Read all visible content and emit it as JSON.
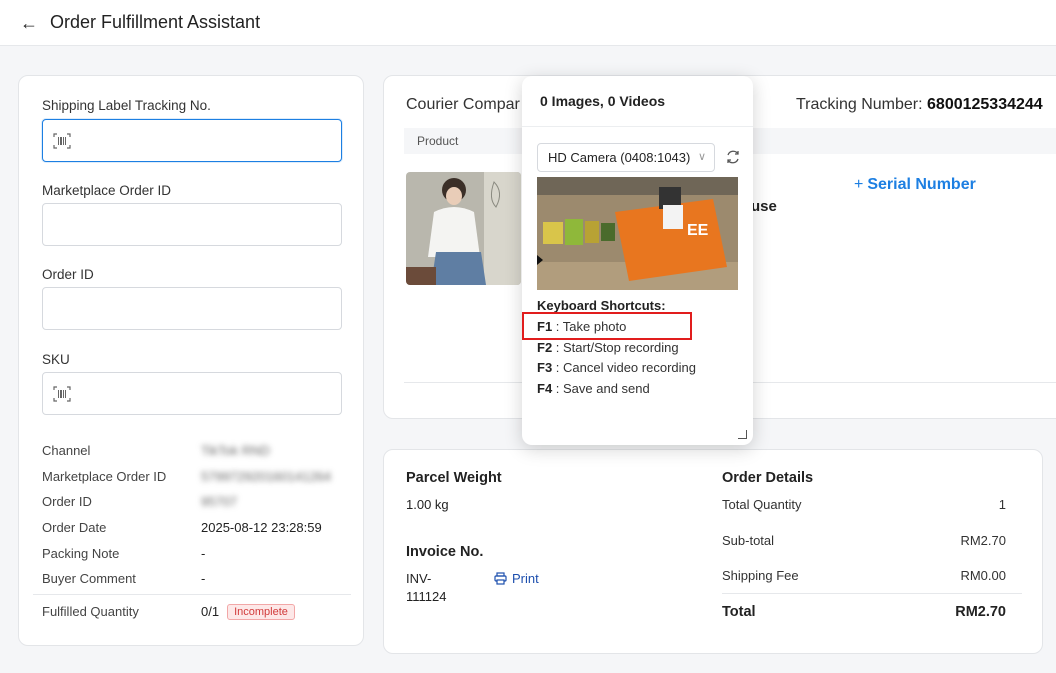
{
  "header": {
    "back_icon": "arrow-left-icon",
    "title": "Order Fulfillment Assistant"
  },
  "left_form": {
    "tracking_label": "Shipping Label Tracking No.",
    "tracking_value": "",
    "marketplace_order_label": "Marketplace Order ID",
    "marketplace_order_value": "",
    "order_id_label": "Order ID",
    "order_id_value": "",
    "sku_label": "SKU",
    "sku_value": ""
  },
  "order_info": [
    {
      "key": "Channel",
      "value": "TikTok RND",
      "blurred": true
    },
    {
      "key": "Marketplace Order ID",
      "value": "579972920160141264",
      "blurred": true
    },
    {
      "key": "Order ID",
      "value": "95707",
      "blurred": true
    },
    {
      "key": "Order Date",
      "value": "2025-08-12 23:28:59",
      "blurred": false
    },
    {
      "key": "Packing Note",
      "value": "-",
      "blurred": false
    },
    {
      "key": "Buyer Comment",
      "value": "-",
      "blurred": false
    }
  ],
  "fulfilled": {
    "label": "Fulfilled Quantity",
    "value": "0/1",
    "status": "Incomplete"
  },
  "shipment": {
    "courier_label": "Courier Compar",
    "tracking_label": "Tracking Number:",
    "tracking_number": "6800125334244",
    "product_header": "Product",
    "house_text": "use",
    "serial_plus": "+",
    "serial_label": "Serial Number"
  },
  "parcel": {
    "weight_title": "Parcel Weight",
    "weight_value": "1.00 kg",
    "invoice_title": "Invoice No.",
    "invoice_value_line1": "INV-",
    "invoice_value_line2": "111124",
    "print_label": "Print"
  },
  "order_details": {
    "title": "Order Details",
    "total_quantity_label": "Total Quantity",
    "total_quantity_value": "1",
    "subtotal_label": "Sub-total",
    "subtotal_value": "RM2.70",
    "shipping_label": "Shipping Fee",
    "shipping_value": "RM0.00",
    "total_label": "Total",
    "total_value": "RM2.70"
  },
  "camera_popup": {
    "header": "0 Images, 0 Videos",
    "camera_selected": "HD Camera (0408:1043)",
    "shortcuts_title": "Keyboard Shortcuts:",
    "shortcuts": [
      {
        "key": "F1",
        "action": " : Take photo"
      },
      {
        "key": "F2",
        "action": " : Start/Stop recording"
      },
      {
        "key": "F3",
        "action": " : Cancel video recording"
      },
      {
        "key": "F4",
        "action": " : Save and send"
      }
    ]
  },
  "colors": {
    "accent": "#1d7fe2",
    "highlight": "#e11d1d",
    "badge_bg": "#fde8e8",
    "badge_text": "#d13b3b"
  }
}
